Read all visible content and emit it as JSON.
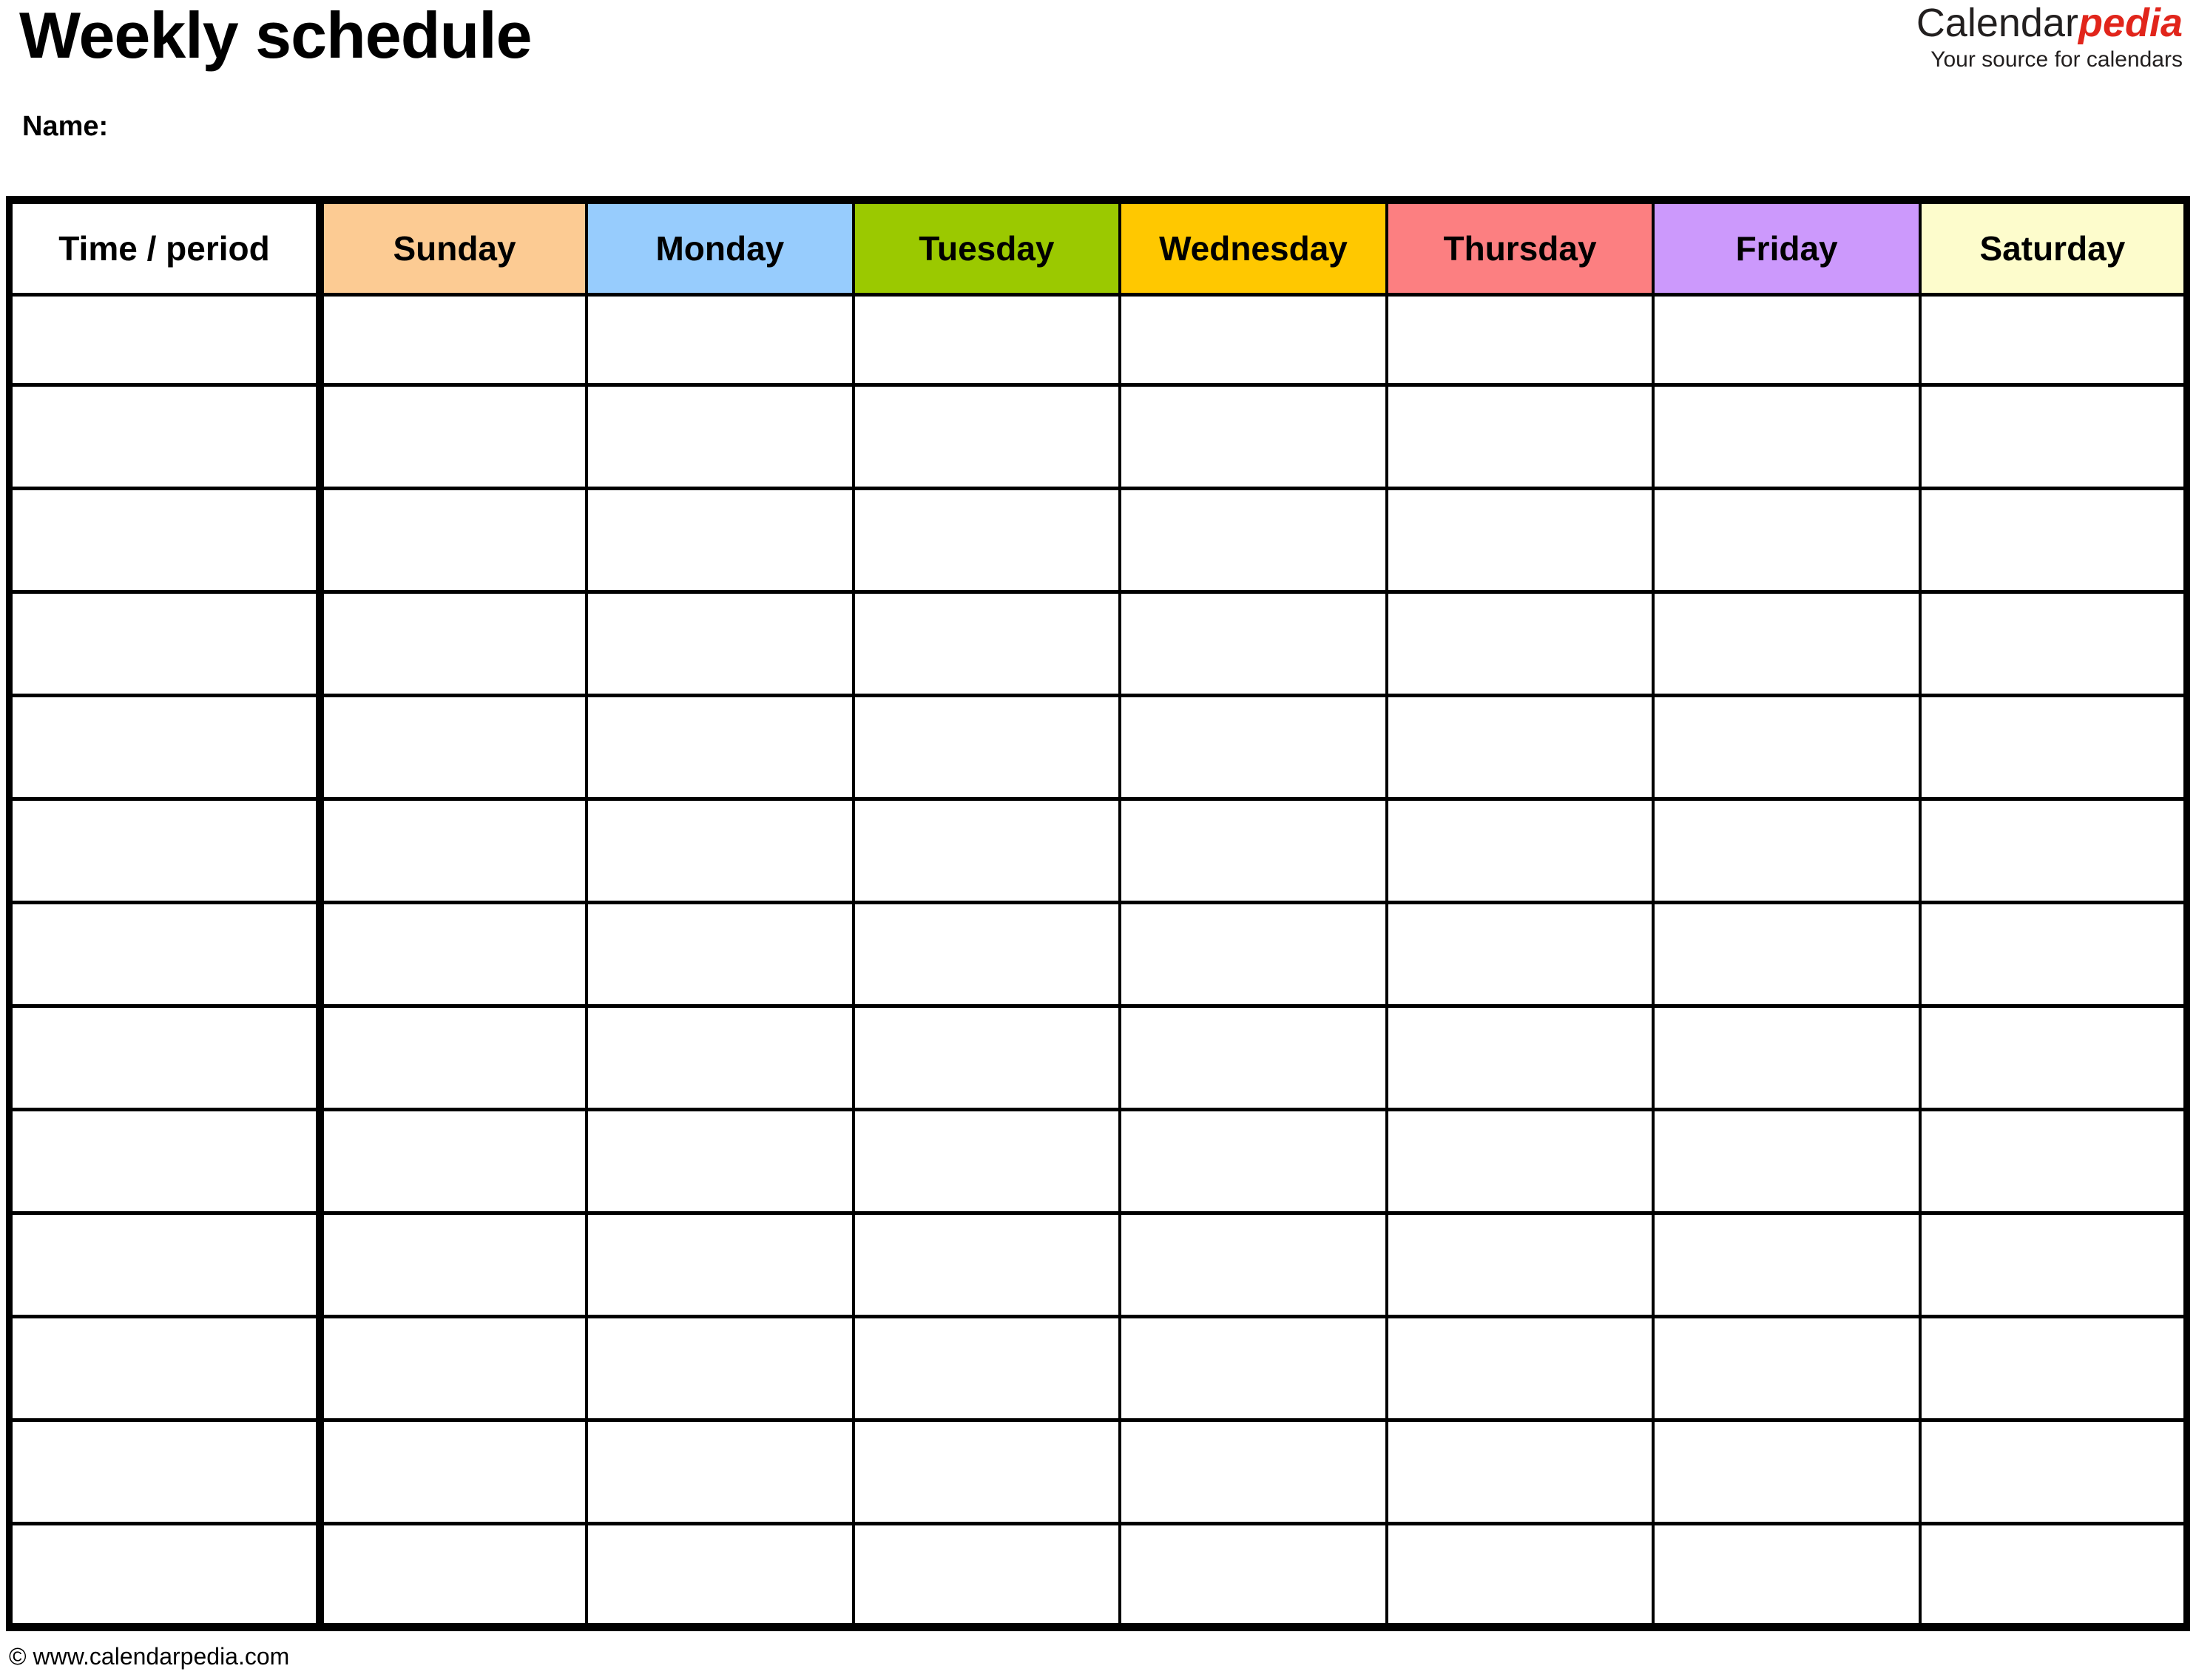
{
  "document": {
    "title": "Weekly schedule",
    "name_label": "Name:"
  },
  "brand": {
    "name_primary": "Calendar",
    "name_accent": "pedia",
    "tagline": "Your source for calendars",
    "accent_color": "#e1251b",
    "primary_color": "#221f1f"
  },
  "table": {
    "columns": [
      {
        "key": "time",
        "label": "Time / period",
        "header_bg": "#ffffff"
      },
      {
        "key": "sunday",
        "label": "Sunday",
        "header_bg": "#fccb93"
      },
      {
        "key": "monday",
        "label": "Monday",
        "header_bg": "#97ccfd"
      },
      {
        "key": "tuesday",
        "label": "Tuesday",
        "header_bg": "#9bc900"
      },
      {
        "key": "wednesday",
        "label": "Wednesday",
        "header_bg": "#ffc800"
      },
      {
        "key": "thursday",
        "label": "Thursday",
        "header_bg": "#fc7f81"
      },
      {
        "key": "friday",
        "label": "Friday",
        "header_bg": "#cc99fc"
      },
      {
        "key": "saturday",
        "label": "Saturday",
        "header_bg": "#fdfccc"
      }
    ],
    "row_count": 13,
    "rows": [
      {
        "time": "",
        "sunday": "",
        "monday": "",
        "tuesday": "",
        "wednesday": "",
        "thursday": "",
        "friday": "",
        "saturday": ""
      },
      {
        "time": "",
        "sunday": "",
        "monday": "",
        "tuesday": "",
        "wednesday": "",
        "thursday": "",
        "friday": "",
        "saturday": ""
      },
      {
        "time": "",
        "sunday": "",
        "monday": "",
        "tuesday": "",
        "wednesday": "",
        "thursday": "",
        "friday": "",
        "saturday": ""
      },
      {
        "time": "",
        "sunday": "",
        "monday": "",
        "tuesday": "",
        "wednesday": "",
        "thursday": "",
        "friday": "",
        "saturday": ""
      },
      {
        "time": "",
        "sunday": "",
        "monday": "",
        "tuesday": "",
        "wednesday": "",
        "thursday": "",
        "friday": "",
        "saturday": ""
      },
      {
        "time": "",
        "sunday": "",
        "monday": "",
        "tuesday": "",
        "wednesday": "",
        "thursday": "",
        "friday": "",
        "saturday": ""
      },
      {
        "time": "",
        "sunday": "",
        "monday": "",
        "tuesday": "",
        "wednesday": "",
        "thursday": "",
        "friday": "",
        "saturday": ""
      },
      {
        "time": "",
        "sunday": "",
        "monday": "",
        "tuesday": "",
        "wednesday": "",
        "thursday": "",
        "friday": "",
        "saturday": ""
      },
      {
        "time": "",
        "sunday": "",
        "monday": "",
        "tuesday": "",
        "wednesday": "",
        "thursday": "",
        "friday": "",
        "saturday": ""
      },
      {
        "time": "",
        "sunday": "",
        "monday": "",
        "tuesday": "",
        "wednesday": "",
        "thursday": "",
        "friday": "",
        "saturday": ""
      },
      {
        "time": "",
        "sunday": "",
        "monday": "",
        "tuesday": "",
        "wednesday": "",
        "thursday": "",
        "friday": "",
        "saturday": ""
      },
      {
        "time": "",
        "sunday": "",
        "monday": "",
        "tuesday": "",
        "wednesday": "",
        "thursday": "",
        "friday": "",
        "saturday": ""
      },
      {
        "time": "",
        "sunday": "",
        "monday": "",
        "tuesday": "",
        "wednesday": "",
        "thursday": "",
        "friday": "",
        "saturday": ""
      }
    ]
  },
  "footer": {
    "credit": "© www.calendarpedia.com"
  }
}
